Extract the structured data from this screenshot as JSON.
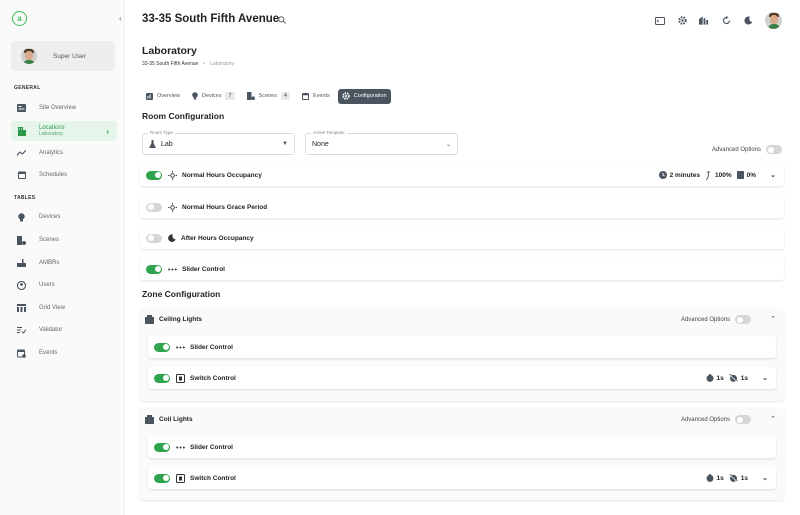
{
  "sidebar": {
    "user_name": "Super User",
    "sections": {
      "general": "GENERAL",
      "tables": "TABLES"
    },
    "general_items": [
      {
        "label": "Site Overview",
        "icon": "site-overview-icon"
      },
      {
        "label": "Locations",
        "sub": "Laboratory",
        "icon": "locations-icon"
      },
      {
        "label": "Analytics",
        "icon": "analytics-icon"
      },
      {
        "label": "Schedules",
        "icon": "calendar-icon"
      }
    ],
    "table_items": [
      {
        "label": "Devices",
        "icon": "bulb-icon"
      },
      {
        "label": "Scenes",
        "icon": "scenes-icon"
      },
      {
        "label": "AMBRs",
        "icon": "ambr-icon"
      },
      {
        "label": "Users",
        "icon": "users-icon"
      },
      {
        "label": "Grid View",
        "icon": "grid-icon"
      },
      {
        "label": "Validator",
        "icon": "validator-icon"
      },
      {
        "label": "Events",
        "icon": "events-icon"
      }
    ]
  },
  "header": {
    "title": "33-35 South Fifth Avenue"
  },
  "page": {
    "title": "Laboratory",
    "breadcrumb": {
      "site": "33-35 South Fifth Avenue",
      "separator": "•",
      "current": "Laboratory"
    }
  },
  "tabs": [
    {
      "label": "Overview"
    },
    {
      "label": "Devices",
      "badge": "7"
    },
    {
      "label": "Scenes",
      "badge": "4"
    },
    {
      "label": "Events"
    },
    {
      "label": "Configuration"
    }
  ],
  "room_config": {
    "title": "Room Configuration",
    "room_type": {
      "label": "Room Type",
      "value": "Lab"
    },
    "active_template": {
      "label": "Active Template",
      "value": "None"
    },
    "advanced_options": "Advanced Options",
    "rows": [
      {
        "label": "Normal Hours Occupancy",
        "on": true,
        "stats": {
          "duration": "2 minutes",
          "occupancy": "100%",
          "level": "0%"
        }
      },
      {
        "label": "Normal Hours Grace Period",
        "on": false
      },
      {
        "label": "After Hours Occupancy",
        "on": false
      },
      {
        "label": "Slider Control",
        "on": true
      }
    ]
  },
  "zone_config": {
    "title": "Zone Configuration",
    "zones": [
      {
        "name": "Ceiling Lights",
        "advanced_options": "Advanced Options",
        "rows": [
          {
            "label": "Slider Control",
            "on": true
          },
          {
            "label": "Switch Control",
            "on": true,
            "t1": "1s",
            "t2": "1s"
          }
        ]
      },
      {
        "name": "Coil Lights",
        "advanced_options": "Advanced Options",
        "rows": [
          {
            "label": "Slider Control",
            "on": true
          },
          {
            "label": "Switch Control",
            "on": true,
            "t1": "1s",
            "t2": "1s"
          }
        ]
      }
    ]
  },
  "colors": {
    "accent": "#2ea44f",
    "tab_active": "#4a5560"
  }
}
